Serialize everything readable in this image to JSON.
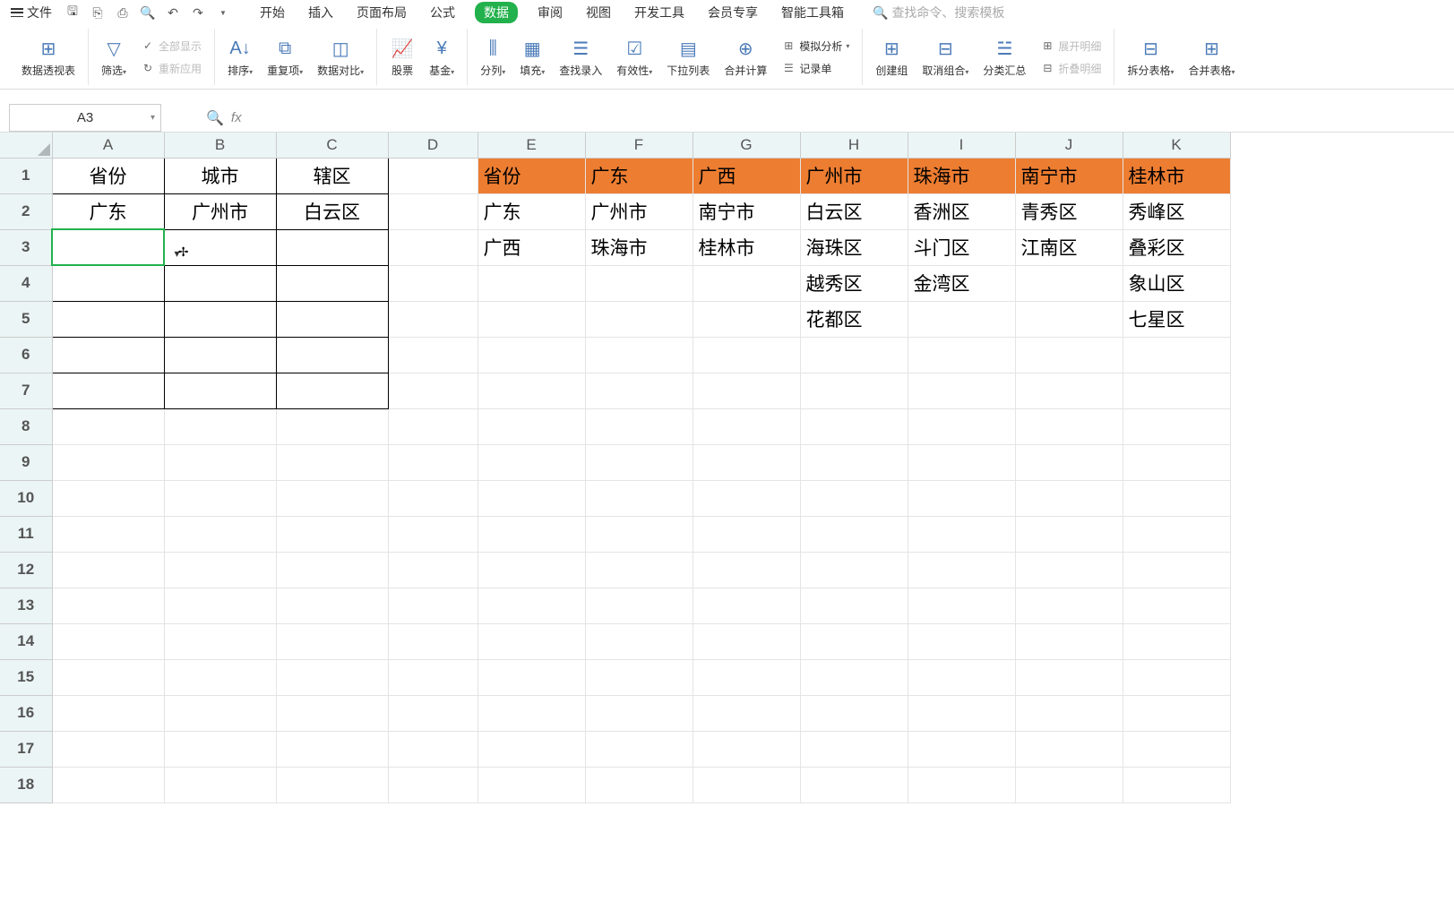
{
  "menu": {
    "file": "文件",
    "tabs": [
      "开始",
      "插入",
      "页面布局",
      "公式",
      "数据",
      "审阅",
      "视图",
      "开发工具",
      "会员专享",
      "智能工具箱"
    ],
    "active_tab": "数据",
    "search_placeholder": "查找命令、搜索模板"
  },
  "ribbon": {
    "pivot": "数据透视表",
    "filter": "筛选",
    "show_all": "全部显示",
    "reapply": "重新应用",
    "sort": "排序",
    "duplicates": "重复项",
    "data_compare": "数据对比",
    "stock": "股票",
    "fund": "基金",
    "text_cols": "分列",
    "fill": "填充",
    "find_entry": "查找录入",
    "validity": "有效性",
    "dropdown_list": "下拉列表",
    "consolidate": "合并计算",
    "what_if": "模拟分析",
    "record_form": "记录单",
    "create_group": "创建组",
    "ungroup": "取消组合",
    "subtotal": "分类汇总",
    "expand_detail": "展开明细",
    "collapse_detail": "折叠明细",
    "split_table": "拆分表格",
    "merge_table": "合并表格"
  },
  "name_box": "A3",
  "columns": [
    "A",
    "B",
    "C",
    "D",
    "E",
    "F",
    "G",
    "H",
    "I",
    "J",
    "K"
  ],
  "rows": [
    "1",
    "2",
    "3",
    "4",
    "5",
    "6",
    "7",
    "8",
    "9",
    "10",
    "11",
    "12",
    "13",
    "14",
    "15",
    "16",
    "17",
    "18"
  ],
  "cells": {
    "A1": "省份",
    "B1": "城市",
    "C1": "辖区",
    "A2": "广东",
    "B2": "广州市",
    "C2": "白云区",
    "E1": "省份",
    "F1": "广东",
    "G1": "广西",
    "H1": "广州市",
    "I1": "珠海市",
    "J1": "南宁市",
    "K1": "桂林市",
    "E2": "广东",
    "F2": "广州市",
    "G2": "南宁市",
    "H2": "白云区",
    "I2": "香洲区",
    "J2": "青秀区",
    "K2": "秀峰区",
    "E3": "广西",
    "F3": "珠海市",
    "G3": "桂林市",
    "H3": "海珠区",
    "I3": "斗门区",
    "J3": "江南区",
    "K3": "叠彩区",
    "H4": "越秀区",
    "I4": "金湾区",
    "K4": "象山区",
    "H5": "花都区",
    "K5": "七星区"
  },
  "selected_cell": "A3"
}
